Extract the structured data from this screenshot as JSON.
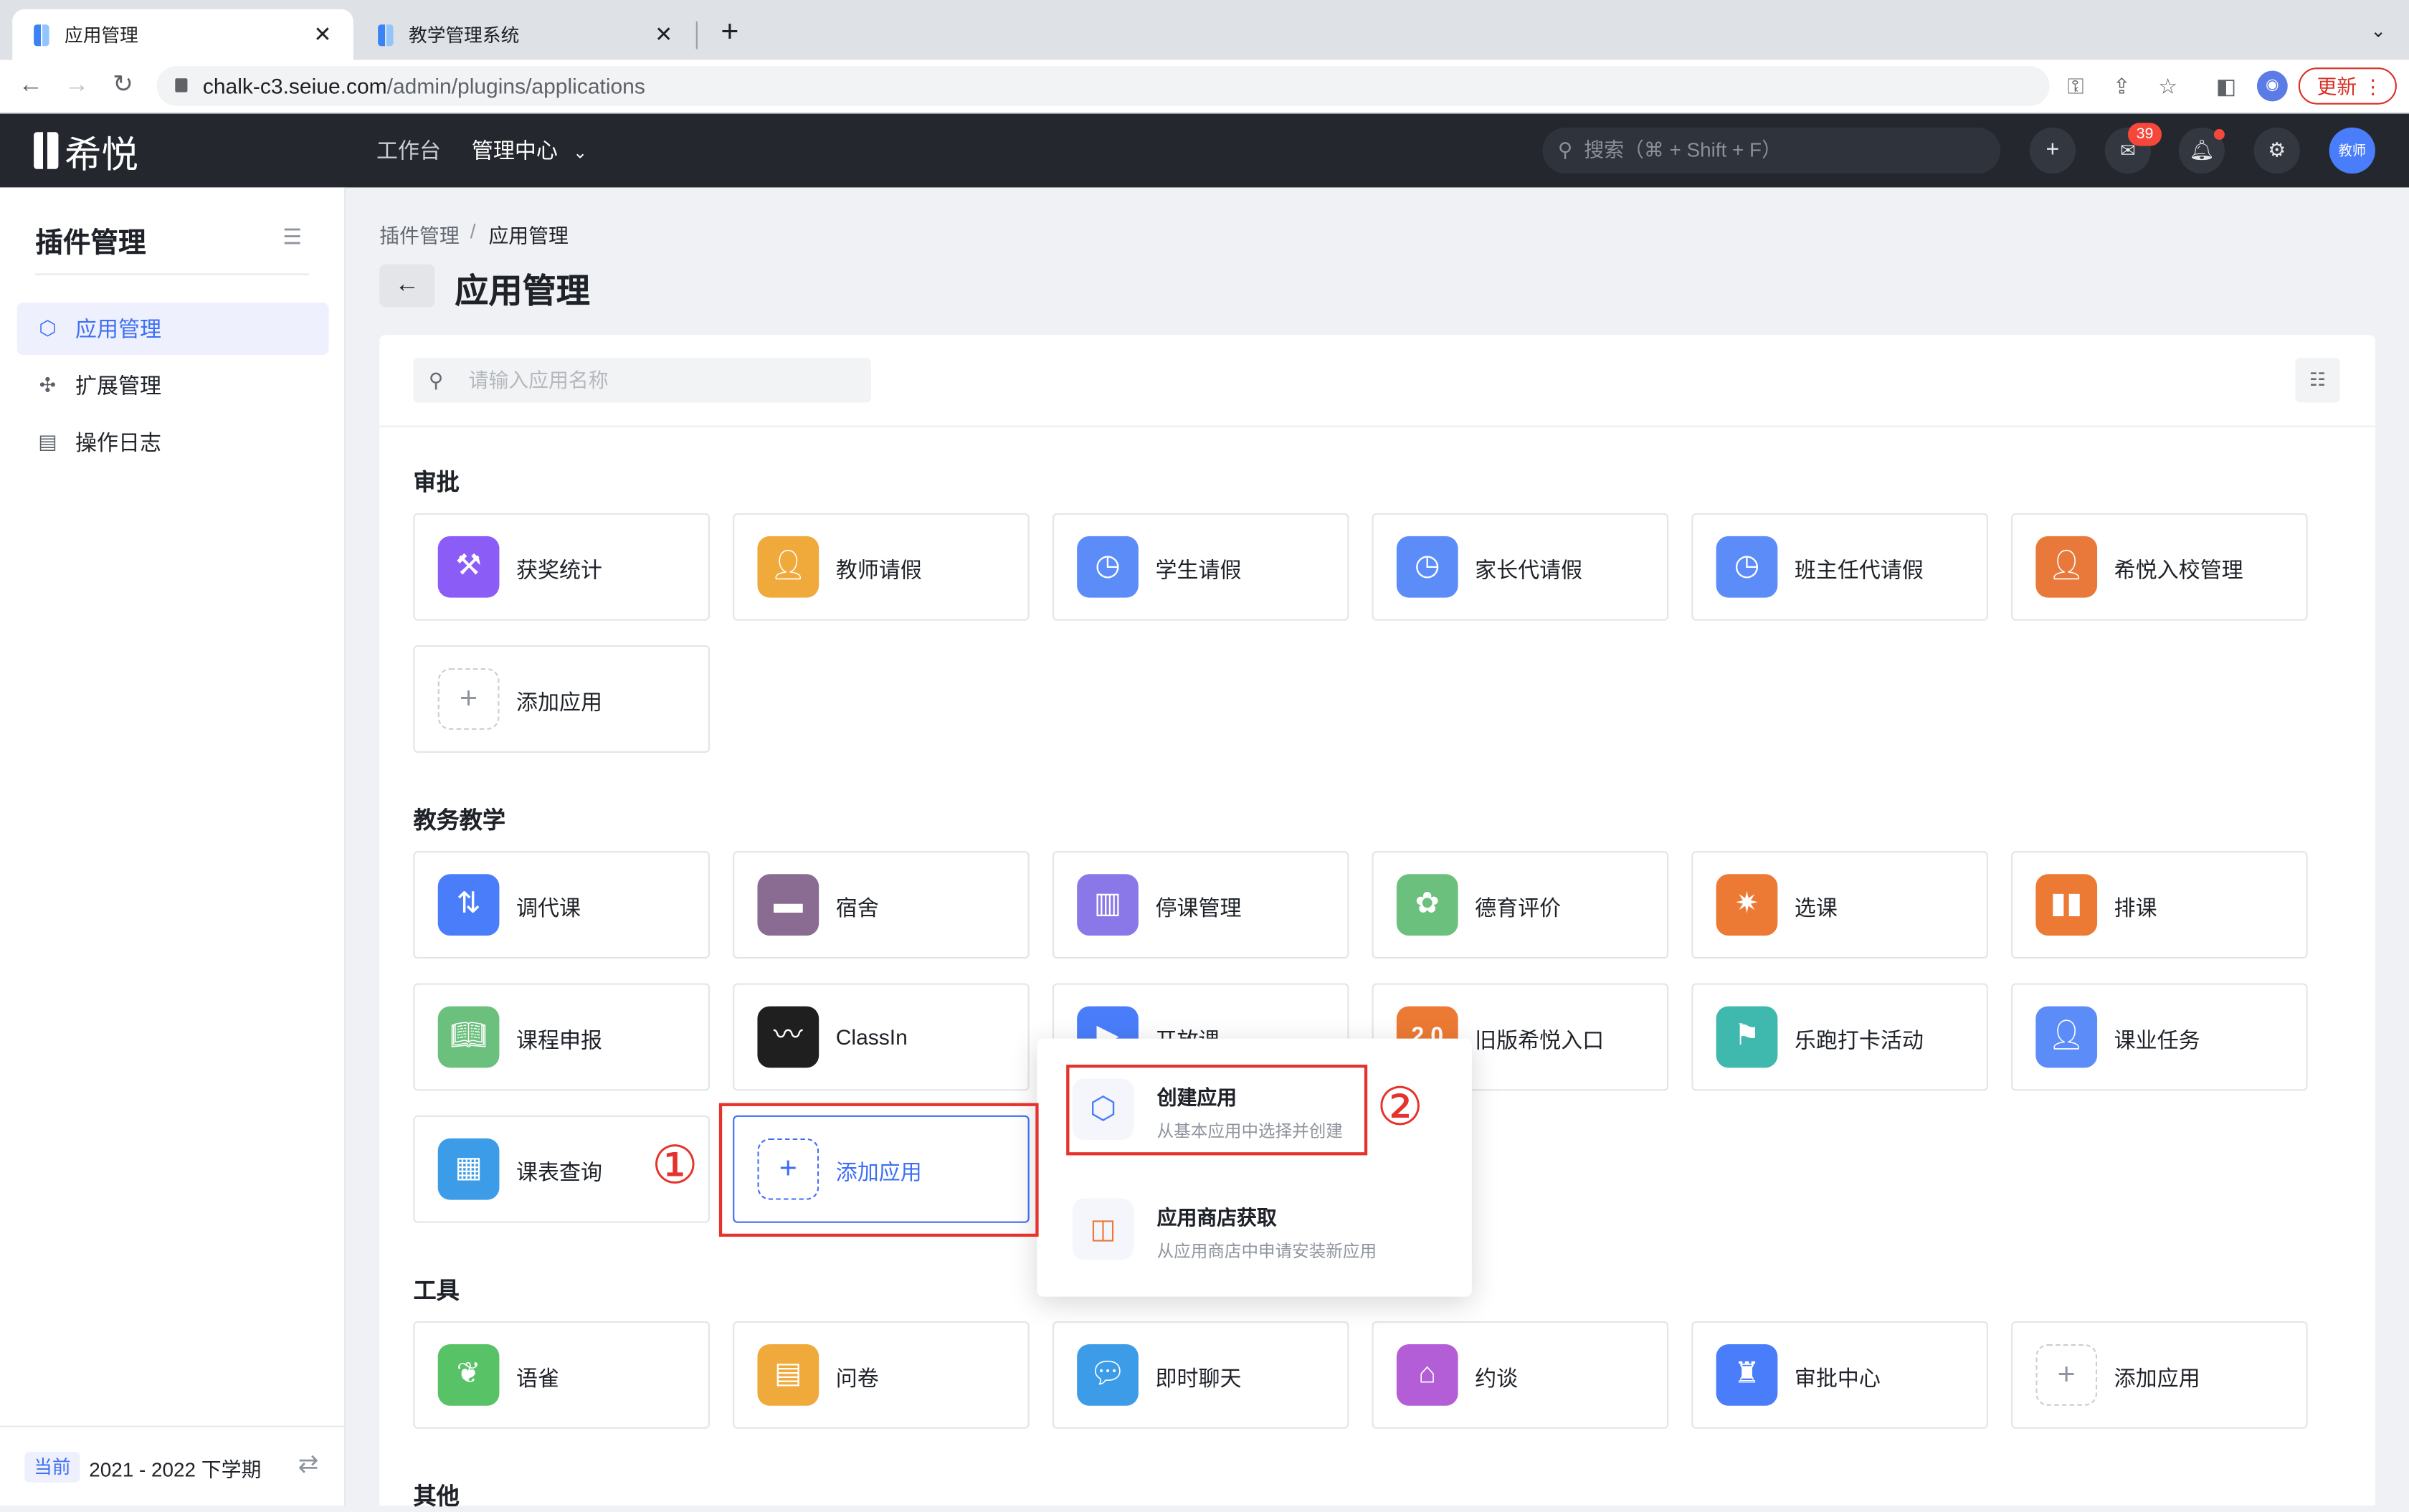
{
  "browser": {
    "tabs": [
      {
        "title": "应用管理",
        "active": true
      },
      {
        "title": "教学管理系统",
        "active": false
      }
    ],
    "new_tab_icon": "plus-icon",
    "url_host": "chalk-c3.seiue.com",
    "url_path": "/admin/plugins/applications",
    "update_label": "更新"
  },
  "header": {
    "logo_text": "希悦",
    "nav": [
      {
        "label": "工作台"
      },
      {
        "label": "管理中心"
      }
    ],
    "search_placeholder": "搜索（⌘ + Shift + F）",
    "message_count": "39",
    "avatar_label": "教师"
  },
  "sidebar": {
    "title": "插件管理",
    "items": [
      {
        "label": "应用管理",
        "icon": "app-icon",
        "active": true
      },
      {
        "label": "扩展管理",
        "icon": "puzzle-icon",
        "active": false
      },
      {
        "label": "操作日志",
        "icon": "log-icon",
        "active": false
      }
    ],
    "term_badge": "当前",
    "term_label": "2021 - 2022 下学期"
  },
  "main": {
    "breadcrumb": [
      "插件管理",
      "应用管理"
    ],
    "breadcrumb_sep": "/",
    "title": "应用管理",
    "search_placeholder": "请输入应用名称",
    "add_label": "添加应用",
    "sections": [
      {
        "title": "审批",
        "apps": [
          "获奖统计",
          "教师请假",
          "学生请假",
          "家长代请假",
          "班主任代请假",
          "希悦入校管理"
        ]
      },
      {
        "title": "教务教学",
        "apps": [
          "调代课",
          "宿舍",
          "停课管理",
          "德育评价",
          "选课",
          "排课",
          "课程申报",
          "ClassIn",
          "开放课",
          "旧版希悦入口",
          "乐跑打卡活动",
          "课业任务",
          "课表查询"
        ]
      },
      {
        "title": "工具",
        "apps": [
          "语雀",
          "问卷",
          "即时聊天",
          "约谈",
          "审批中心"
        ]
      },
      {
        "title": "其他",
        "apps": []
      }
    ],
    "colors": {
      "accent": "#3d6ef5",
      "annotation_red": "#e5322d"
    }
  },
  "popup": {
    "items": [
      {
        "title": "创建应用",
        "subtitle": "从基本应用中选择并创建"
      },
      {
        "title": "应用商店获取",
        "subtitle": "从应用商店中申请安装新应用"
      }
    ]
  },
  "annotations": {
    "step1": "①",
    "step2": "②"
  }
}
